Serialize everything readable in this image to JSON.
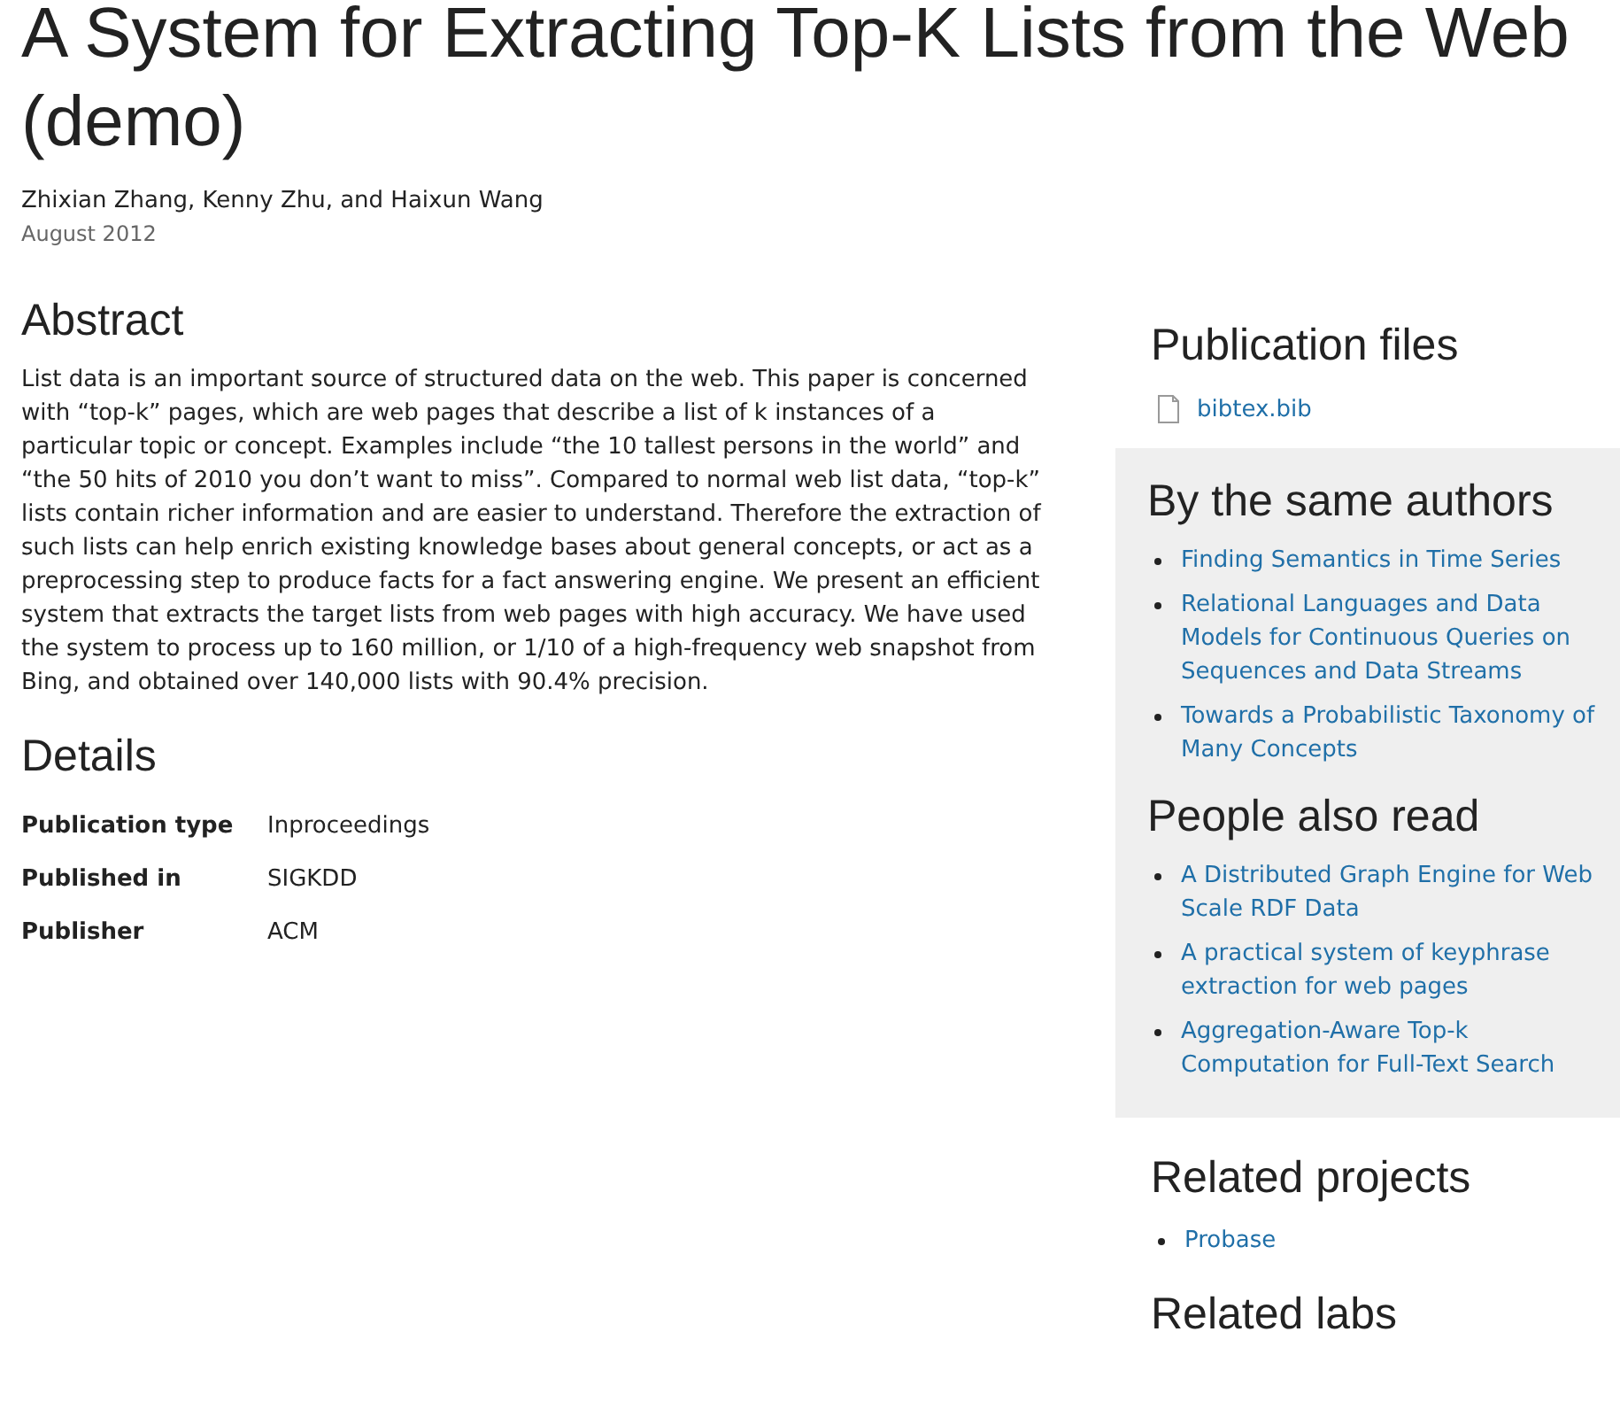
{
  "title": "A System for Extracting Top-K Lists from the Web (demo)",
  "authors": "Zhixian Zhang, Kenny Zhu, and Haixun Wang",
  "date": "August 2012",
  "abstract": {
    "heading": "Abstract",
    "text": "List data is an important source of structured data on the web. This paper is concerned with “top-k” pages, which are web pages that describe a list of k instances of a particular topic or concept. Examples include “the 10 tallest persons in the world” and “the 50 hits of 2010 you don’t want to miss”. Compared to normal web list data, “top-k” lists contain richer information and are easier to understand. Therefore the extraction of such lists can help enrich existing knowledge bases about general concepts, or act as a preprocessing step to produce facts for a fact answering engine. We present an efficient system that extracts the target lists from web pages with high accuracy. We have used the system to process up to 160 million, or 1/10 of a high-frequency web snapshot from Bing, and obtained over 140,000 lists with 90.4% precision."
  },
  "details": {
    "heading": "Details",
    "rows": [
      {
        "label": "Publication type",
        "value": "Inproceedings"
      },
      {
        "label": "Published in",
        "value": "SIGKDD"
      },
      {
        "label": "Publisher",
        "value": "ACM"
      }
    ]
  },
  "publication_files": {
    "heading": "Publication files",
    "files": [
      "bibtex.bib"
    ]
  },
  "same_authors": {
    "heading": "By the same authors",
    "items": [
      "Finding Semantics in Time Series",
      "Relational Languages and Data Models for Continuous Queries on Sequences and Data Streams",
      "Towards a Probabilistic Taxonomy of Many Concepts"
    ]
  },
  "also_read": {
    "heading": "People also read",
    "items": [
      "A Distributed Graph Engine for Web Scale RDF Data",
      "A practical system of keyphrase extraction for web pages",
      "Aggregation-Aware Top-k Computation for Full-Text Search"
    ]
  },
  "related_projects": {
    "heading": "Related projects",
    "items": [
      "Probase"
    ]
  },
  "related_labs": {
    "heading": "Related labs"
  }
}
